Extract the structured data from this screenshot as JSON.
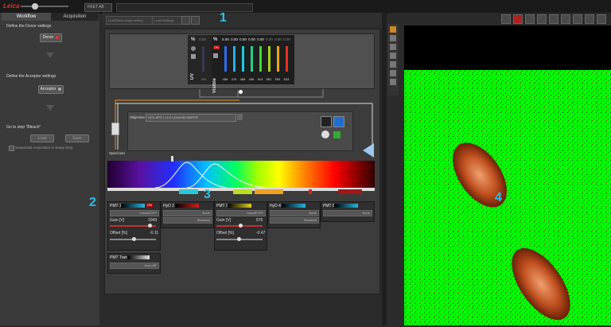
{
  "topbar": {
    "logo": "Leica",
    "fret_tag": "FRET AB"
  },
  "left_panel": {
    "tabs": [
      {
        "label": "Workflow"
      },
      {
        "label": "Acquisition"
      }
    ],
    "donor_heading": "Define the Donor settings",
    "donor_button": "Donor",
    "acceptor_heading": "Define the Acceptor settings",
    "acceptor_button": "Acceptor",
    "bleach_heading": "Go to step \"Bleach\"",
    "load_button": "Load",
    "save_button": "Save",
    "sequential_label": "Sequential Acquisition In Setup Step"
  },
  "settings_bar": {
    "field1": "Load/Save single setting",
    "field2": "Load Settings"
  },
  "laser_panel": {
    "uv": {
      "label": "UV",
      "pct": "0.00",
      "wavelength": "405"
    },
    "visible": {
      "label": "Visible",
      "on_label": "ON",
      "lines": [
        {
          "pct": "5.00",
          "wl": "458",
          "color": "#2f6cf0"
        },
        {
          "pct": "0.00",
          "wl": "476",
          "color": "#2ab0e8"
        },
        {
          "pct": "0.00",
          "wl": "488",
          "color": "#20c8d8"
        },
        {
          "pct": "0.00",
          "wl": "496",
          "color": "#22d28a"
        },
        {
          "pct": "0.00",
          "wl": "514",
          "color": "#42d838"
        },
        {
          "pct": "0.00",
          "wl": "561",
          "color": "#a8d020"
        },
        {
          "pct": "0.00",
          "wl": "594",
          "color": "#e8a818"
        },
        {
          "pct": "0.00",
          "wl": "633",
          "color": "#e83020"
        }
      ]
    }
  },
  "objective": {
    "label": "Objective:",
    "value": "HCX APO L U-V-I 40x/0.80 WATER"
  },
  "specimen_label": "Specimen",
  "detectors": [
    {
      "name": "PMT 1",
      "status": "ON",
      "dye": "Leica/ECFP",
      "gain_label": "Gain [V]",
      "gain": "1049",
      "offset_label": "Offset [%]",
      "offset": "-0.11",
      "bar": "#2ab4e0"
    },
    {
      "name": "HyD 2",
      "status": "",
      "dye": "None",
      "mode": "Standard",
      "bar": "#d02020"
    },
    {
      "name": "PMT 3",
      "status": "",
      "dye": "Leica/EYFP",
      "gain_label": "Gain [V]",
      "gain": "576",
      "offset_label": "Offset [%]",
      "offset": "-0.47",
      "bar": "#e0d020"
    },
    {
      "name": "HyD 4",
      "status": "",
      "dye": "None",
      "mode": "Standard",
      "bar": "#2ab4e0"
    },
    {
      "name": "PMT 5",
      "status": "",
      "dye": "None",
      "bar": "#2ab4e0"
    }
  ],
  "pmt_trans": {
    "name": "PMT Trans",
    "mode": "Scan-BF"
  },
  "callouts": [
    "1",
    "2",
    "3",
    "4"
  ],
  "colors": {
    "accent_cyan": "#29c3e8",
    "image_green": "#00ff00",
    "cell_red": "#b03010"
  }
}
